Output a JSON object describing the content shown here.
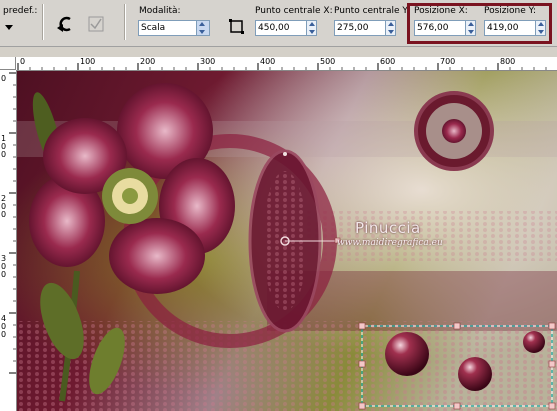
{
  "toolbar": {
    "preset_label": "predef.:",
    "mode_label": "Modalità:",
    "mode_value": "Scala",
    "center_x_label": "Punto centrale X:",
    "center_x_value": "450,00",
    "center_y_label": "Punto centrale Y:",
    "center_y_value": "275,00",
    "pos_x_label": "Posizione X:",
    "pos_x_value": "576,00",
    "pos_y_label": "Posizione Y:",
    "pos_y_value": "419,00"
  },
  "ruler": {
    "h_ticks": [
      "0",
      "100",
      "200",
      "300",
      "400",
      "500",
      "600",
      "700",
      "800"
    ],
    "v_ticks": [
      "0",
      "100",
      "200",
      "300",
      "400"
    ]
  },
  "canvas": {
    "watermark_name": "Pinuccia",
    "watermark_url": "www.maidiregrafica.eu"
  },
  "colors": {
    "highlight": "#7a1320",
    "bg_dark": "#5a1428",
    "bg_olive": "#7a7a24"
  }
}
